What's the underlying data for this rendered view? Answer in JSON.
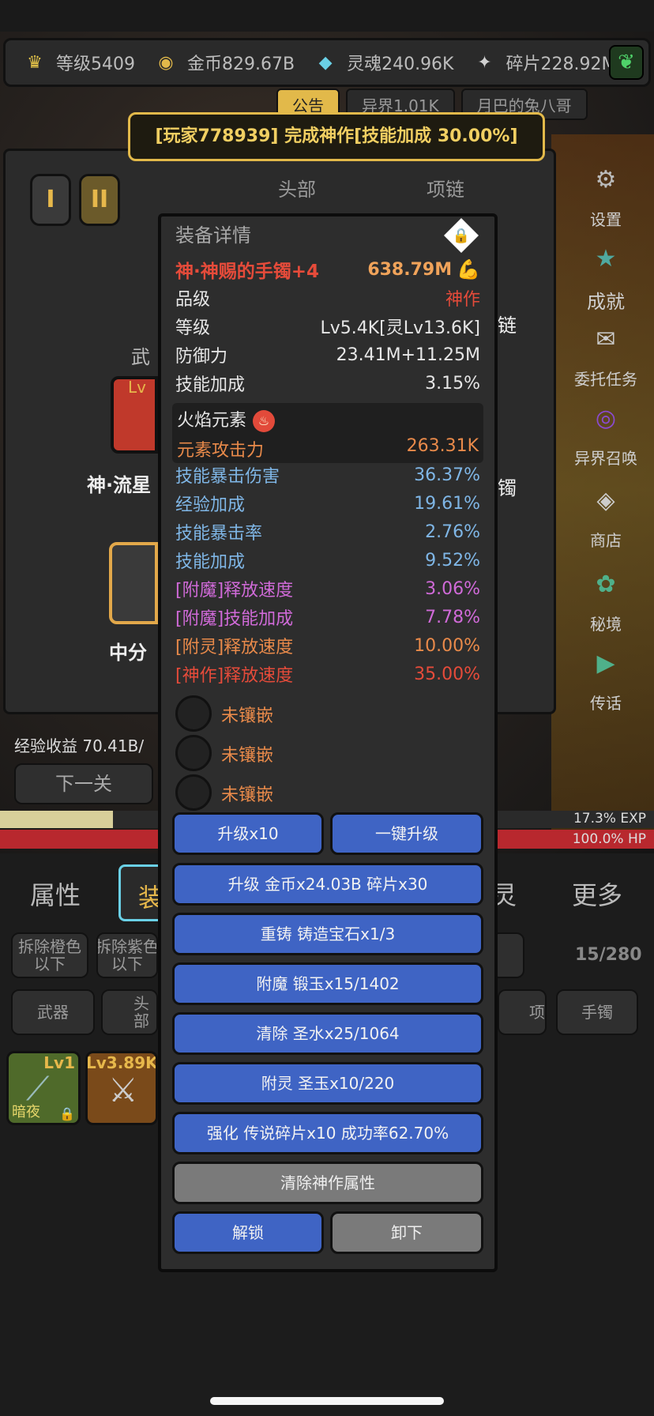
{
  "colors": {
    "accent_gold": "#f1cf62",
    "legendary_red": "#e54b3a",
    "blue_stat": "#7fb6e6",
    "purple_stat": "#d06ad8",
    "orange_stat": "#e98a4a",
    "button_blue": "#3f64c4"
  },
  "resources": [
    {
      "icon": "crown-icon",
      "glyph": "♛",
      "color": "#e7c64a",
      "label": "等级5409"
    },
    {
      "icon": "gold-coin-icon",
      "glyph": "◉",
      "color": "#e2b94a",
      "label": "金币829.67B"
    },
    {
      "icon": "soul-icon",
      "glyph": "◆",
      "color": "#6ad0e6",
      "label": "灵魂240.96K"
    },
    {
      "icon": "shard-icon",
      "glyph": "✦",
      "color": "#d0d0d0",
      "label": "碎片228.92M"
    }
  ],
  "top_tabs": {
    "notice": "公告",
    "otherworld": "异界1.01K",
    "player": "月巴的兔八哥"
  },
  "announcement": "[玩家778939] 完成神作[技能加成 30.00%]",
  "left_panel": {
    "roman_1": "I",
    "roman_2": "II",
    "slot_head": "头部",
    "slot_necklace": "项链",
    "weapon_prefix": "武",
    "weapon_lv": "Lv",
    "weapon_name": "神·流星",
    "middle_name": "中分",
    "right_char_1": "链",
    "right_char_2": "镯",
    "exp_income": "经验收益 70.41B/",
    "next_level": "下一关"
  },
  "side_menu": [
    {
      "icon": "gear-icon",
      "glyph": "⚙",
      "label": "设置"
    },
    {
      "icon": "star-icon",
      "glyph": "★",
      "label": "成就"
    },
    {
      "icon": "commission-icon",
      "glyph": "✉",
      "label": "委托任务"
    },
    {
      "icon": "portal-icon",
      "glyph": "◎",
      "label": "异界召唤"
    },
    {
      "icon": "shop-icon",
      "glyph": "◈",
      "label": "商店"
    },
    {
      "icon": "secret-realm-icon",
      "glyph": "✿",
      "label": "秘境"
    },
    {
      "icon": "megaphone-icon",
      "glyph": "📢",
      "label": "传话"
    }
  ],
  "bars": {
    "exp_fraction": 0.173,
    "exp_text": "17.3% EXP",
    "hp_fraction": 1.0,
    "hp_text": "100.0% HP"
  },
  "bottom_tabs": {
    "attributes": "属性",
    "equipment": "装",
    "spirit": "灵",
    "more": "更多"
  },
  "filters": {
    "dismantle_orange": "拆除橙色\n以下",
    "dismantle_purple": "拆除紫色\n以下",
    "count": "15/280"
  },
  "categories": {
    "weapon": "武器",
    "head": "头部",
    "necklace": "项链",
    "bracelet": "手镯"
  },
  "items": [
    {
      "label": "Lv1",
      "sub": "暗夜"
    },
    {
      "label": "Lv3.89K",
      "sub": ""
    }
  ],
  "modal": {
    "title": "装备详情",
    "item_name": "神·神赐的手镯+4",
    "power": "638.79M",
    "rows": [
      {
        "label": "品级",
        "value": "神作",
        "value_color": "#e54b3a"
      },
      {
        "label": "等级",
        "value": "Lv5.4K[灵Lv13.6K]",
        "value_color": "#e6e6e6"
      },
      {
        "label": "防御力",
        "value": "23.41M+11.25M",
        "value_color": "#e6e6e6"
      },
      {
        "label": "技能加成",
        "value": "3.15%",
        "value_color": "#e6e6e6"
      }
    ],
    "element_name": "火焰元素",
    "element_attack_label": "元素攻击力",
    "element_attack_value": "263.31K",
    "affixes": [
      {
        "label": "技能暴击伤害",
        "value": "36.37%",
        "color": "#7fb6e6"
      },
      {
        "label": "经验加成",
        "value": "19.61%",
        "color": "#7fb6e6"
      },
      {
        "label": "技能暴击率",
        "value": "2.76%",
        "color": "#7fb6e6"
      },
      {
        "label": "技能加成",
        "value": "9.52%",
        "color": "#7fb6e6"
      },
      {
        "label": "[附魔]释放速度",
        "value": "3.06%",
        "color": "#d06ad8"
      },
      {
        "label": "[附魔]技能加成",
        "value": "7.78%",
        "color": "#d06ad8"
      },
      {
        "label": "[附灵]释放速度",
        "value": "10.00%",
        "color": "#e98a4a"
      },
      {
        "label": "[神作]释放速度",
        "value": "35.00%",
        "color": "#e54b3a"
      }
    ],
    "sockets": [
      "未镶嵌",
      "未镶嵌",
      "未镶嵌"
    ],
    "buttons": {
      "upgrade10": "升级x10",
      "one_click_upgrade": "一键升级",
      "upgrade_cost": "升级 金币x24.03B 碎片x30",
      "reforge": "重铸 铸造宝石x1/3",
      "enchant": "附魔 锻玉x15/1402",
      "purge": "清除 圣水x25/1064",
      "spirit_attach": "附灵 圣玉x10/220",
      "strengthen": "强化 传说碎片x10 成功率62.70%",
      "clear_masterwork": "清除神作属性",
      "unlock": "解锁",
      "unequip": "卸下"
    }
  }
}
